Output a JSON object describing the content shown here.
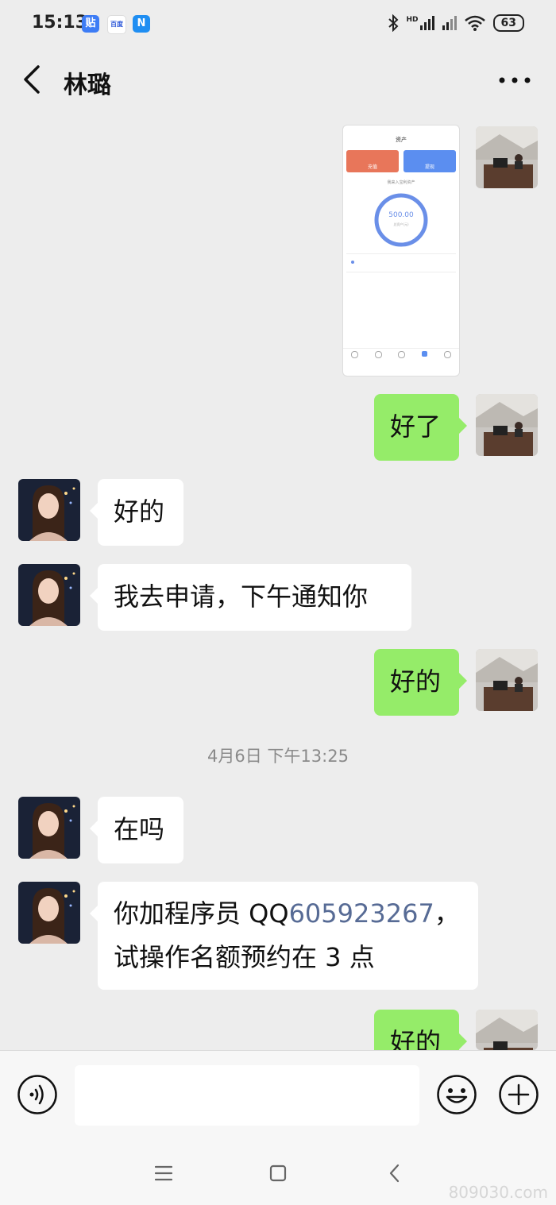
{
  "status_bar": {
    "time": "15:13",
    "app_icons": [
      "贴",
      "百度",
      "N"
    ],
    "network_label": "HD",
    "battery": "63"
  },
  "header": {
    "title": "林璐",
    "back_icon": "chevron-left-icon",
    "more_icon": "more-horizontal-icon"
  },
  "screenshot_image": {
    "page_title": "资产",
    "action_left": "充值",
    "action_right": "提现",
    "caption": "我来入宝利资产",
    "gauge_value": "500.00",
    "gauge_sub": "总资产(元)",
    "tab_icons": [
      "首页",
      "行情",
      "交易",
      "资产",
      "我的"
    ]
  },
  "messages": [
    {
      "side": "right",
      "text": "好了"
    },
    {
      "side": "left",
      "text": "好的"
    },
    {
      "side": "left",
      "text": "我去申请，下午通知你"
    },
    {
      "side": "right",
      "text": "好的"
    },
    {
      "side": "left",
      "text": "在吗"
    },
    {
      "side": "left",
      "line1_prefix": "你加程序员 QQ",
      "line1_link": "605923267",
      "line1_suffix": "，",
      "line2": "试操作名额预约在 3 点"
    },
    {
      "side": "right",
      "text": "好的"
    }
  ],
  "timestamp": "4月6日 下午13:25",
  "input_bar": {
    "placeholder": "",
    "voice_icon": "voice-icon",
    "emoji_icon": "emoji-icon",
    "plus_icon": "plus-icon"
  },
  "nav_bar": [
    "menu-icon",
    "home-icon",
    "back-icon"
  ],
  "watermark": "809030.com",
  "colors": {
    "background": "#ededed",
    "sent_bubble": "#95ec69",
    "received_bubble": "#ffffff",
    "link": "#576b95"
  }
}
